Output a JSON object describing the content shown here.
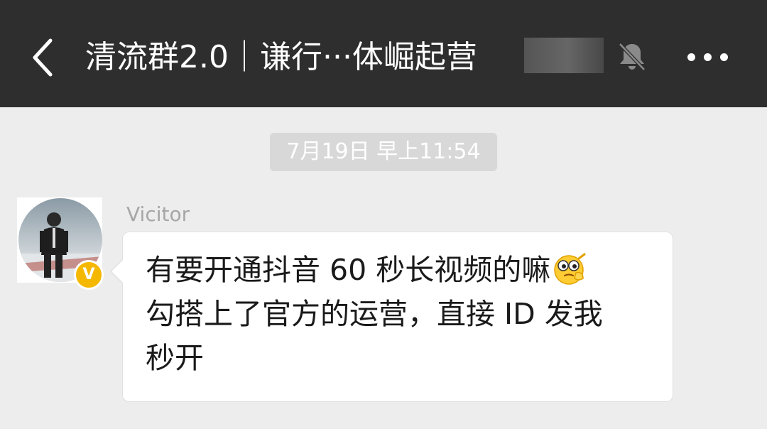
{
  "header": {
    "title": "清流群2.0｜谦行···体崛起营"
  },
  "chat": {
    "timestamp": "7月19日 早上11:54",
    "messages": [
      {
        "sender": "Vicitor",
        "verified_badge": "V",
        "lines": [
          "有要开通抖音 60 秒长视频的嘛",
          "勾搭上了官方的运营，直接 ID 发我",
          "秒开"
        ],
        "emoji": "thinking-face-emoji"
      }
    ]
  },
  "icons": {
    "back": "chevron-left-icon",
    "mute": "bell-off-icon",
    "more": "more-dots-icon"
  },
  "colors": {
    "topbar": "#2e2e2e",
    "background": "#ededed",
    "badge": "#f5b800"
  }
}
